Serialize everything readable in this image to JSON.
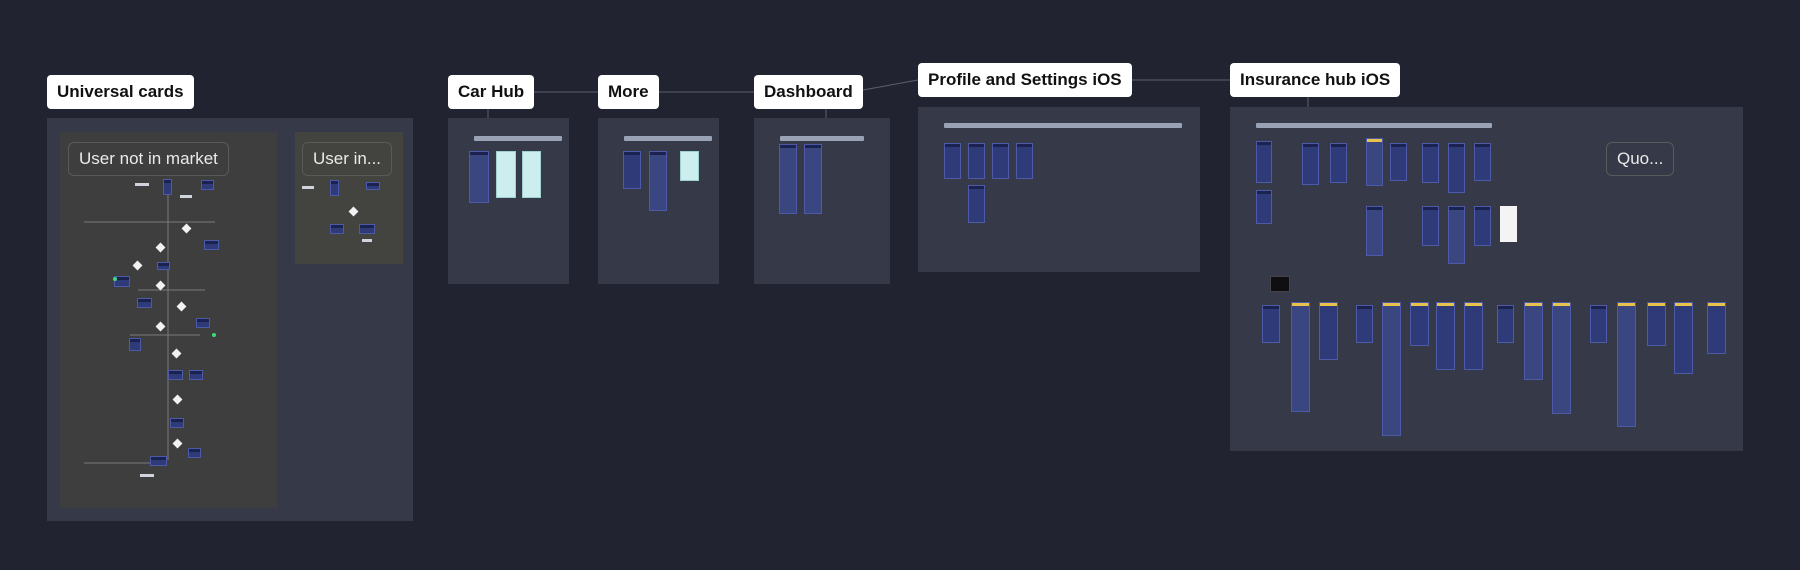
{
  "canvas": {
    "background": "#212330"
  },
  "sections": {
    "universal_cards": {
      "title": "Universal cards",
      "subsections": {
        "not_in_market": "User not in market",
        "in_market": "User in..."
      }
    },
    "car_hub": {
      "title": "Car Hub"
    },
    "more": {
      "title": "More"
    },
    "dashboard": {
      "title": "Dashboard"
    },
    "profile_settings": {
      "title": "Profile and Settings iOS"
    },
    "insurance_hub": {
      "title": "Insurance hub iOS",
      "quote_label": "Quo..."
    }
  },
  "colors": {
    "section_bg": "#363a48",
    "subsection_bg": "#3e3e3e",
    "screen_blue": "#2f3a78",
    "label_bg": "#ffffff",
    "accent_yellow": "#e8c24a",
    "accent_green": "#3fd97a",
    "panel_teal": "#cdeeee"
  }
}
